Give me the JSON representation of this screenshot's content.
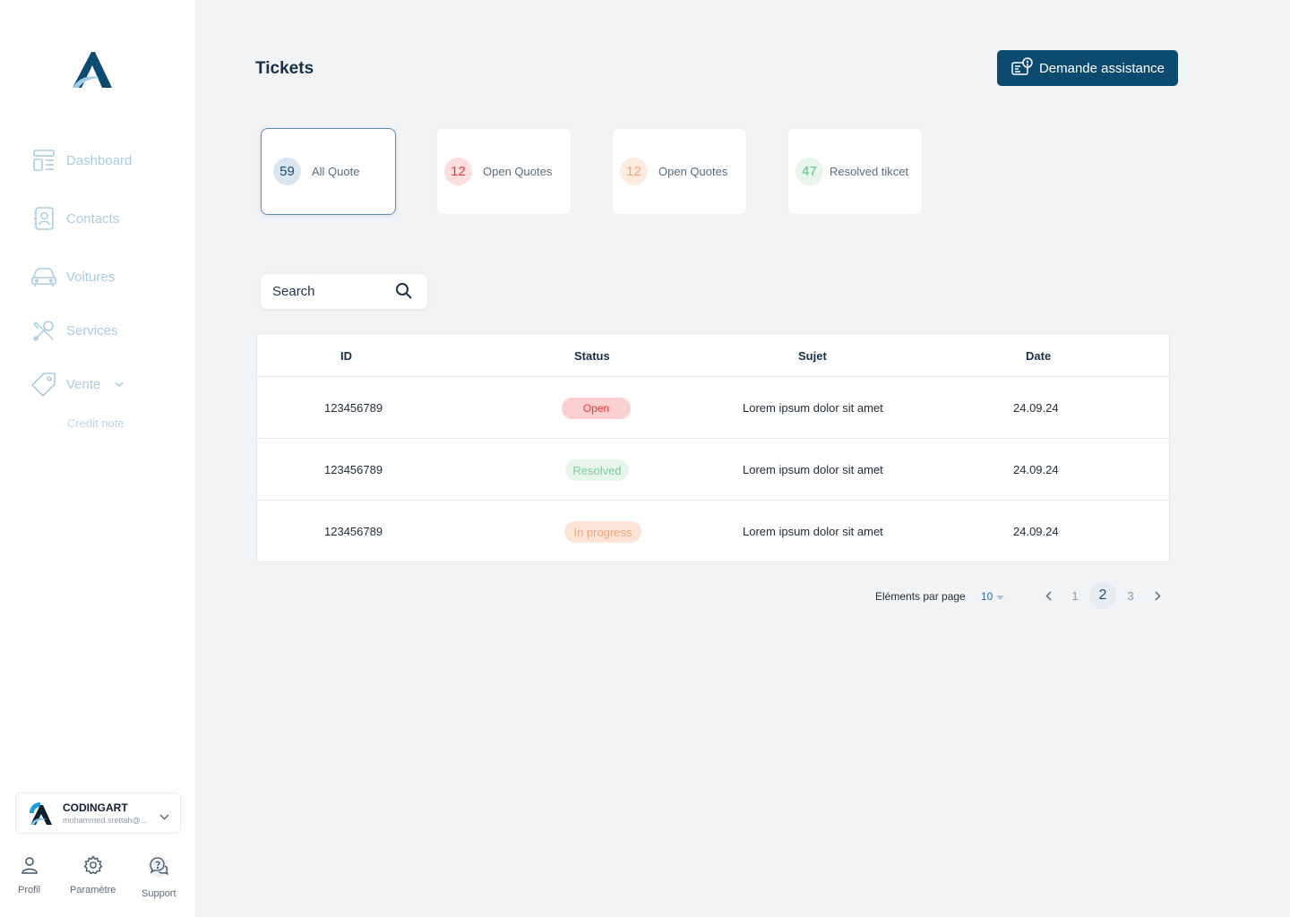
{
  "sidebar": {
    "nav": [
      {
        "label": "Dashboard",
        "icon": "dashboard-icon"
      },
      {
        "label": "Contacts",
        "icon": "contacts-icon"
      },
      {
        "label": "Voitures",
        "icon": "car-icon"
      },
      {
        "label": "Services",
        "icon": "tools-icon"
      },
      {
        "label": "Vente",
        "icon": "tag-icon"
      }
    ],
    "sub_item": "Credit note",
    "account": {
      "name": "CODINGART",
      "email": "mohammed.srettah@..."
    },
    "bottom": [
      {
        "label": "Profil",
        "icon": "user-icon"
      },
      {
        "label": "Paramètre",
        "icon": "gear-icon"
      },
      {
        "label": "Support",
        "icon": "support-icon"
      }
    ]
  },
  "header": {
    "title": "Tickets",
    "assist_label": "Demande assistance"
  },
  "stats": [
    {
      "count": "59",
      "label": "All Quote",
      "badge_bg": "#d9e6ef",
      "badge_fg": "#1d4d74"
    },
    {
      "count": "12",
      "label": "Open Quotes",
      "badge_bg": "#fcdede",
      "badge_fg": "#e33a3a"
    },
    {
      "count": "12",
      "label": "Open Quotes",
      "badge_bg": "#fdebe0",
      "badge_fg": "#f4a574"
    },
    {
      "count": "47",
      "label": "Resolved tikcet",
      "badge_bg": "#e6f6ea",
      "badge_fg": "#5cc480"
    }
  ],
  "search": {
    "placeholder": "Search"
  },
  "table": {
    "columns": [
      "ID",
      "Status",
      "Sujet",
      "Date"
    ],
    "rows": [
      {
        "id": "123456789",
        "status": "Open",
        "subject": "Lorem ipsum dolor sit amet",
        "date": "24.09.24"
      },
      {
        "id": "123456789",
        "status": "Resolved",
        "subject": "Lorem ipsum dolor sit amet",
        "date": "24.09.24"
      },
      {
        "id": "123456789",
        "status": "In progress",
        "subject": "Lorem ipsum dolor sit amet",
        "date": "24.09.24"
      }
    ],
    "status_colors": {
      "open": {
        "bg": "#fbcfcf",
        "fg": "#e0332f"
      },
      "resolved": {
        "bg": "#e6f6ea",
        "fg": "#7cc999"
      },
      "in_progress": {
        "bg": "#fde4d7",
        "fg": "#f3a57c"
      }
    }
  },
  "pagination": {
    "per_page_label": "Eléments par page",
    "per_page_value": "10",
    "pages": [
      "1",
      "2",
      "3"
    ],
    "current": "2"
  },
  "colors": {
    "brand": "#0d4a70",
    "nav_text": "#a9cbe0"
  }
}
